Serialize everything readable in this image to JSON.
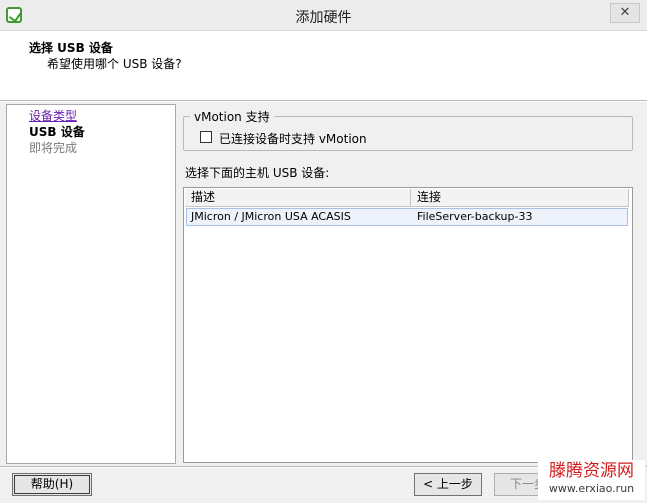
{
  "window": {
    "title": "添加硬件",
    "close_glyph": "✕"
  },
  "header": {
    "title": "选择 USB 设备",
    "subtitle": "希望使用哪个 USB 设备?"
  },
  "steps": [
    {
      "label": "设备类型",
      "state": "visited"
    },
    {
      "label": "USB 设备",
      "state": "current"
    },
    {
      "label": "即将完成",
      "state": "future"
    }
  ],
  "vmotion": {
    "group_label": "vMotion 支持",
    "checkbox_label": "已连接设备时支持 vMotion",
    "checked": false
  },
  "device_list": {
    "label": "选择下面的主机 USB 设备:",
    "columns": [
      "描述",
      "连接"
    ],
    "rows": [
      {
        "description": "JMicron / JMicron USA ACASIS",
        "connection": "FileServer-backup-33"
      }
    ]
  },
  "buttons": {
    "help": "帮助(H)",
    "back": "< 上一步",
    "next": "下一步"
  },
  "watermark": {
    "line1": "滕腾资源网",
    "line2": "www.erxiao.run"
  },
  "colors": {
    "visited_link": "#6b1fb3",
    "selection_bg": "#eef3fb",
    "watermark_red": "#d01e1e"
  }
}
